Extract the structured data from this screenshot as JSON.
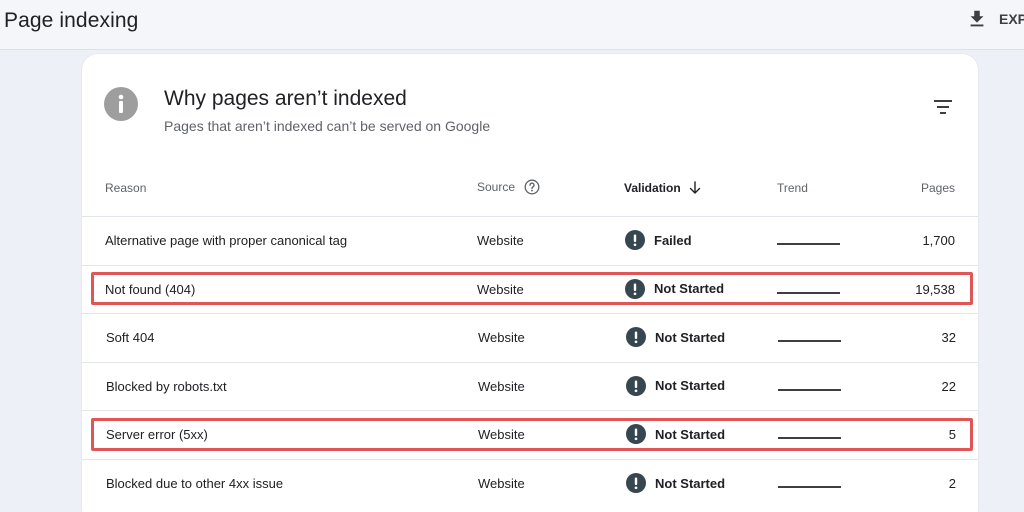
{
  "header": {
    "title": "Page indexing",
    "export_label": "EXP"
  },
  "card": {
    "title": "Why pages aren’t indexed",
    "subtitle": "Pages that aren’t indexed can’t be served on Google"
  },
  "table": {
    "columns": {
      "reason": "Reason",
      "source": "Source",
      "validation": "Validation",
      "trend": "Trend",
      "pages": "Pages"
    },
    "rows": [
      {
        "reason": "Alternative page with proper canonical tag",
        "source": "Website",
        "validation": "Failed",
        "pages": "1,700",
        "highlighted": false
      },
      {
        "reason": "Not found (404)",
        "source": "Website",
        "validation": "Not Started",
        "pages": "19,538",
        "highlighted": true
      },
      {
        "reason": "Soft 404",
        "source": "Website",
        "validation": "Not Started",
        "pages": "32",
        "highlighted": false
      },
      {
        "reason": "Blocked by robots.txt",
        "source": "Website",
        "validation": "Not Started",
        "pages": "22",
        "highlighted": false
      },
      {
        "reason": "Server error (5xx)",
        "source": "Website",
        "validation": "Not Started",
        "pages": "5",
        "highlighted": true
      },
      {
        "reason": "Blocked due to other 4xx issue",
        "source": "Website",
        "validation": "Not Started",
        "pages": "2",
        "highlighted": false
      }
    ]
  },
  "colors": {
    "highlight": "#e05555",
    "alert_icon": "#37474f",
    "info_icon": "#9e9e9e"
  },
  "icons": {
    "info": "info-icon",
    "filter": "filter-icon",
    "download": "download-icon",
    "help": "help-icon",
    "sort": "arrow-down-icon",
    "alert": "alert-icon"
  }
}
